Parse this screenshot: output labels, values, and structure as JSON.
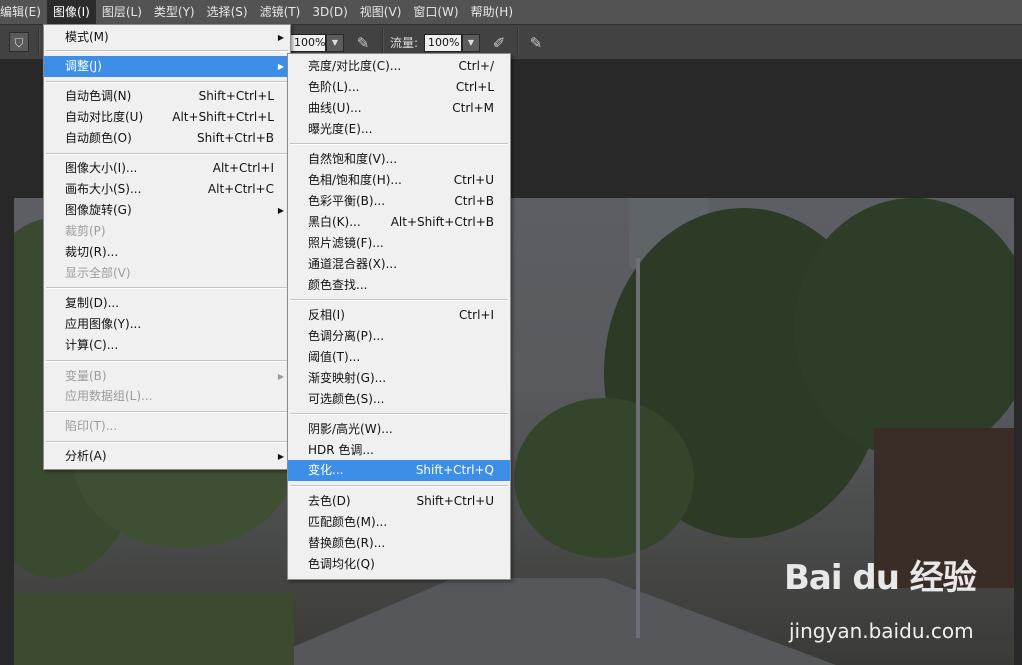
{
  "menubar": {
    "items": [
      "编辑(E)",
      "图像(I)",
      "图层(L)",
      "类型(Y)",
      "选择(S)",
      "滤镜(T)",
      "3D(D)",
      "视图(V)",
      "窗口(W)",
      "帮助(H)"
    ]
  },
  "options": {
    "opacity_value": "100%",
    "flow_label": "流量:",
    "flow_value": "100%"
  },
  "image_menu": {
    "items": [
      {
        "label": "模式(M)",
        "has_submenu": true
      },
      {
        "label": "调整(J)",
        "has_submenu": true,
        "highlighted": true
      },
      {
        "label": "自动色调(N)",
        "shortcut": "Shift+Ctrl+L"
      },
      {
        "label": "自动对比度(U)",
        "shortcut": "Alt+Shift+Ctrl+L"
      },
      {
        "label": "自动颜色(O)",
        "shortcut": "Shift+Ctrl+B"
      },
      {
        "label": "图像大小(I)...",
        "shortcut": "Alt+Ctrl+I"
      },
      {
        "label": "画布大小(S)...",
        "shortcut": "Alt+Ctrl+C"
      },
      {
        "label": "图像旋转(G)",
        "has_submenu": true
      },
      {
        "label": "裁剪(P)",
        "disabled": true
      },
      {
        "label": "裁切(R)..."
      },
      {
        "label": "显示全部(V)",
        "disabled": true
      },
      {
        "label": "复制(D)..."
      },
      {
        "label": "应用图像(Y)..."
      },
      {
        "label": "计算(C)..."
      },
      {
        "label": "变量(B)",
        "has_submenu": true,
        "disabled": true
      },
      {
        "label": "应用数据组(L)...",
        "disabled": true
      },
      {
        "label": "陷印(T)...",
        "disabled": true
      },
      {
        "label": "分析(A)",
        "has_submenu": true
      }
    ]
  },
  "adjust_menu": {
    "items": [
      {
        "label": "亮度/对比度(C)...",
        "shortcut": "Ctrl+/"
      },
      {
        "label": "色阶(L)...",
        "shortcut": "Ctrl+L"
      },
      {
        "label": "曲线(U)...",
        "shortcut": "Ctrl+M"
      },
      {
        "label": "曝光度(E)..."
      },
      {
        "label": "自然饱和度(V)..."
      },
      {
        "label": "色相/饱和度(H)...",
        "shortcut": "Ctrl+U"
      },
      {
        "label": "色彩平衡(B)...",
        "shortcut": "Ctrl+B"
      },
      {
        "label": "黑白(K)...",
        "shortcut": "Alt+Shift+Ctrl+B"
      },
      {
        "label": "照片滤镜(F)..."
      },
      {
        "label": "通道混合器(X)..."
      },
      {
        "label": "颜色查找..."
      },
      {
        "label": "反相(I)",
        "shortcut": "Ctrl+I"
      },
      {
        "label": "色调分离(P)..."
      },
      {
        "label": "阈值(T)..."
      },
      {
        "label": "渐变映射(G)..."
      },
      {
        "label": "可选颜色(S)..."
      },
      {
        "label": "阴影/高光(W)..."
      },
      {
        "label": "HDR 色调..."
      },
      {
        "label": "变化...",
        "shortcut": "Shift+Ctrl+Q",
        "highlighted": true
      },
      {
        "label": "去色(D)",
        "shortcut": "Shift+Ctrl+U"
      },
      {
        "label": "匹配颜色(M)..."
      },
      {
        "label": "替换颜色(R)..."
      },
      {
        "label": "色调均化(Q)"
      }
    ]
  },
  "watermark": {
    "brand": "Bai du 经验",
    "url": "jingyan.baidu.com"
  },
  "colors": {
    "menubar_bg": "#535353",
    "menu_bg": "#f0f0f0",
    "highlight": "#3d8ee6"
  }
}
